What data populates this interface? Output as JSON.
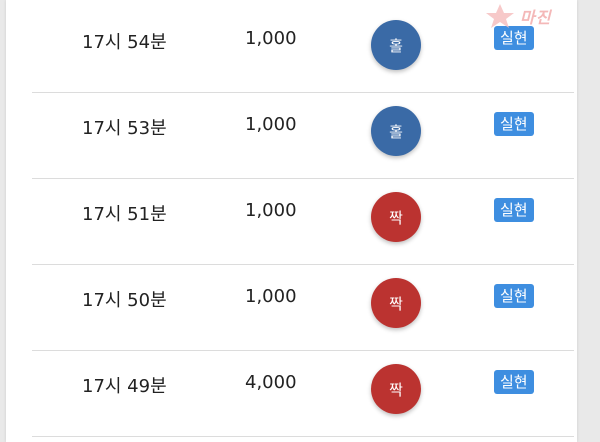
{
  "logo": {
    "text": "마진"
  },
  "colors": {
    "hole": "#3a6aa6",
    "jjak": "#bb3330",
    "badge": "#3e8ee0"
  },
  "rows": [
    {
      "time": "17시 54분",
      "amount": "1,000",
      "result": "홀",
      "result_type": "hole",
      "status": "실현"
    },
    {
      "time": "17시 53분",
      "amount": "1,000",
      "result": "홀",
      "result_type": "hole",
      "status": "실현"
    },
    {
      "time": "17시 51분",
      "amount": "1,000",
      "result": "짝",
      "result_type": "jjak",
      "status": "실현"
    },
    {
      "time": "17시 50분",
      "amount": "1,000",
      "result": "짝",
      "result_type": "jjak",
      "status": "실현"
    },
    {
      "time": "17시 49분",
      "amount": "4,000",
      "result": "짝",
      "result_type": "jjak",
      "status": "실현"
    }
  ]
}
